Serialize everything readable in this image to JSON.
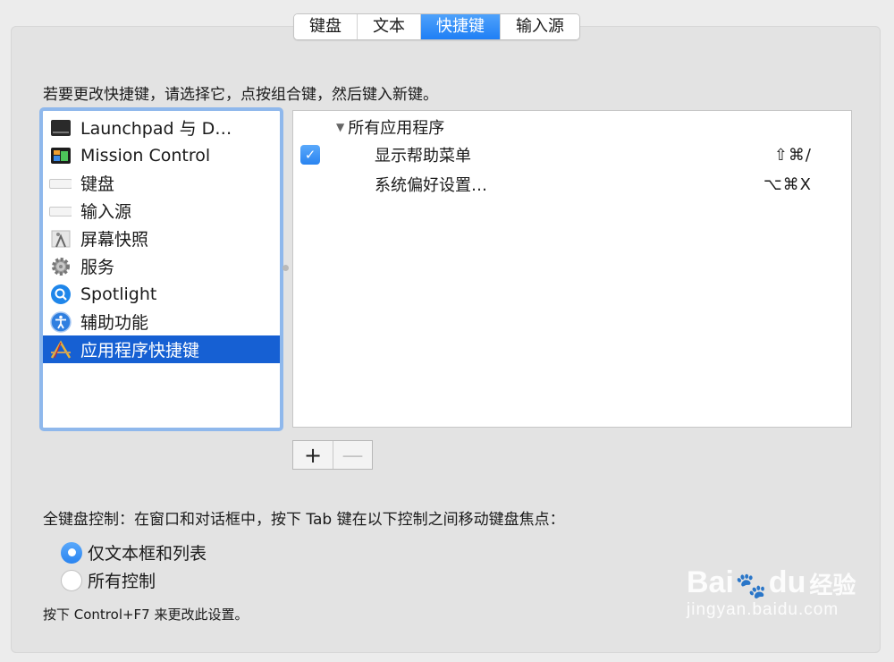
{
  "tabs": [
    {
      "label": "键盘",
      "active": false
    },
    {
      "label": "文本",
      "active": false
    },
    {
      "label": "快捷键",
      "active": true
    },
    {
      "label": "输入源",
      "active": false
    }
  ],
  "instruction": "若要更改快捷键，请选择它，点按组合键，然后键入新键。",
  "categories": [
    {
      "label": "Launchpad 与 D…",
      "icon": "launchpad-icon",
      "selected": false
    },
    {
      "label": "Mission Control",
      "icon": "mission-control-icon",
      "selected": false
    },
    {
      "label": "键盘",
      "icon": "keyboard-icon",
      "selected": false
    },
    {
      "label": "输入源",
      "icon": "input-source-icon",
      "selected": false
    },
    {
      "label": "屏幕快照",
      "icon": "screenshot-icon",
      "selected": false
    },
    {
      "label": "服务",
      "icon": "gear-icon",
      "selected": false
    },
    {
      "label": "Spotlight",
      "icon": "spotlight-icon",
      "selected": false
    },
    {
      "label": "辅助功能",
      "icon": "accessibility-icon",
      "selected": false
    },
    {
      "label": "应用程序快捷键",
      "icon": "app-shortcuts-icon",
      "selected": true
    }
  ],
  "shortcuts": {
    "group": "所有应用程序",
    "rows": [
      {
        "label": "显示帮助菜单",
        "keys": "⇧⌘/",
        "checked": true
      },
      {
        "label": "系统偏好设置…",
        "keys": "⌥⌘X",
        "checked": null
      }
    ]
  },
  "buttons": {
    "add": "+",
    "remove": "—"
  },
  "full_keyboard": {
    "label": "全键盘控制：在窗口和对话框中，按下 Tab 键在以下控制之间移动键盘焦点：",
    "options": [
      {
        "label": "仅文本框和列表",
        "selected": true
      },
      {
        "label": "所有控制",
        "selected": false
      }
    ],
    "hint": "按下 Control+F7 来更改此设置。"
  },
  "watermark": {
    "brand": "Bai",
    "brand2": "du",
    "cn": "经验",
    "url": "jingyan.baidu.com"
  }
}
